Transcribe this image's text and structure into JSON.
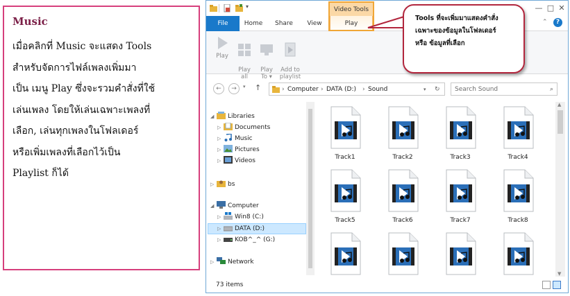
{
  "card": {
    "title": "Music",
    "body": "เมื่อคลิกที่ Music จะแสดง Tools\nสำหรับจัดการไฟล์เพลงเพิ่มมา\nเป็น เมนู Play ซึ่งจะรวมคำสั่งที่ใช้\nเล่นเพลง โดยให้เล่นเฉพาะเพลงที่\nเลือก, เล่นทุกเพลงในโฟลเดอร์\nหรือเพิ่มเพลงที่เลือกไว้เป็น\nPlaylist ก็ได้"
  },
  "callout": {
    "text": "Tools ที่จะเพิ่มมาแสดงคำสั่ง\nเฉพาะของข้อมูลในโฟลเดอร์\nหรือ ข้อมูลที่เลือก"
  },
  "window": {
    "context_tab_header": "Video Tools",
    "tabs": [
      "File",
      "Home",
      "Share",
      "View",
      "Play"
    ],
    "ribbon": {
      "play": "Play",
      "play_all": "Play\nall",
      "play_to": "Play\nTo ▾",
      "add_to_playlist": "Add to\nplaylist"
    },
    "address": {
      "crumbs": [
        "Computer",
        "DATA (D:)",
        "Sound"
      ],
      "search_placeholder": "Search Sound"
    },
    "nav": {
      "libraries": "Libraries",
      "documents": "Documents",
      "music": "Music",
      "pictures": "Pictures",
      "videos": "Videos",
      "bs": "bs",
      "computer": "Computer",
      "win8": "Win8 (C:)",
      "data": "DATA (D:)",
      "kob": "KOB^_^ (G:)",
      "network": "Network"
    },
    "files": [
      "Track1",
      "Track2",
      "Track3",
      "Track4",
      "Track5",
      "Track6",
      "Track7",
      "Track8",
      "",
      "",
      "",
      ""
    ],
    "status": "73 items"
  },
  "colors": {
    "card_border": "#d63f7c",
    "card_title": "#7b1f47",
    "file_tab": "#1979ca",
    "context_tab": "#fbd8a6",
    "context_highlight": "#f0a636",
    "callout_border": "#b2263d",
    "selection": "#cce8ff"
  }
}
